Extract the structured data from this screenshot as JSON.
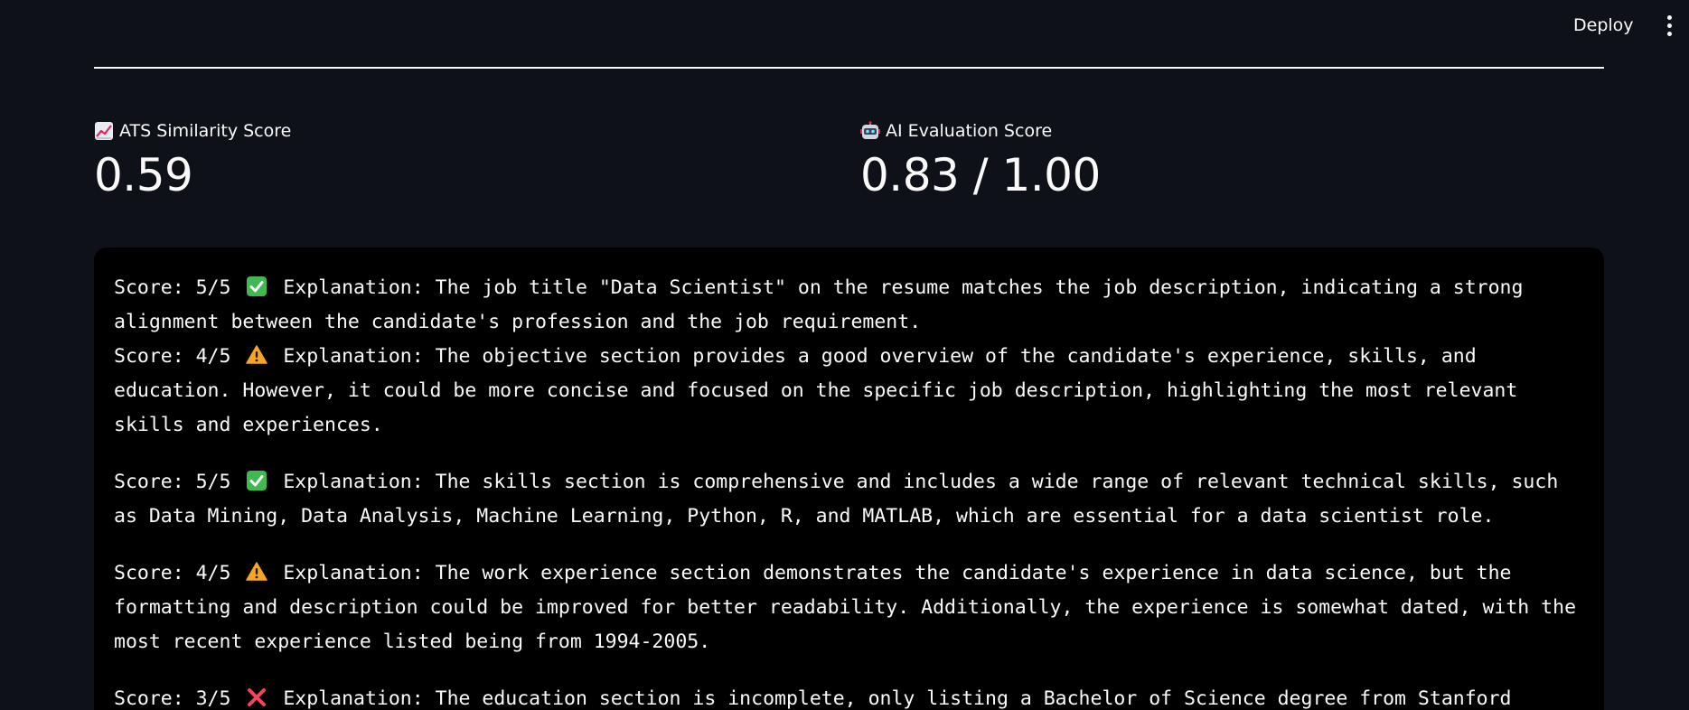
{
  "header": {
    "deploy_label": "Deploy",
    "menu_icon": "more-vertical-icon"
  },
  "metrics": [
    {
      "icon": "chart-increasing-icon",
      "label": "ATS Similarity Score",
      "value": "0.59"
    },
    {
      "icon": "robot-icon",
      "label": "AI Evaluation Score",
      "value": "0.83 / 1.00"
    }
  ],
  "evaluation": {
    "entries": [
      {
        "score": "Score: 5/5",
        "status": "check",
        "text": "Explanation: The job title \"Data Scientist\" on the resume matches the job description, indicating a strong alignment between the candidate's profession and the job requirement."
      },
      {
        "score": "Score: 4/5",
        "status": "warning",
        "text": "Explanation: The objective section provides a good overview of the candidate's experience, skills, and education. However, it could be more concise and focused on the specific job description, highlighting the most relevant skills and experiences."
      },
      {
        "score": "Score: 5/5",
        "status": "check",
        "text": "Explanation: The skills section is comprehensive and includes a wide range of relevant technical skills, such as Data Mining, Data Analysis, Machine Learning, Python, R, and MATLAB, which are essential for a data scientist role."
      },
      {
        "score": "Score: 4/5",
        "status": "warning",
        "text": "Explanation: The work experience section demonstrates the candidate's experience in data science, but the formatting and description could be improved for better readability. Additionally, the experience is somewhat dated, with the most recent experience listed being from 1994-2005."
      },
      {
        "score": "Score: 3/5",
        "status": "cross",
        "text": "Explanation: The education section is incomplete, only listing a Bachelor of Science degree from Stanford"
      }
    ]
  },
  "colors": {
    "background": "#0e1117",
    "code_background": "#000000",
    "text": "#fafafa",
    "check": "#3fb950",
    "warning": "#f5a623",
    "cross": "#f5455c"
  }
}
